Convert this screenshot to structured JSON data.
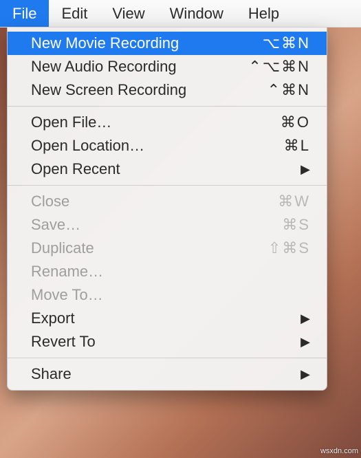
{
  "menubar": {
    "items": [
      {
        "label": "File",
        "active": true
      },
      {
        "label": "Edit",
        "active": false
      },
      {
        "label": "View",
        "active": false
      },
      {
        "label": "Window",
        "active": false
      },
      {
        "label": "Help",
        "active": false
      }
    ]
  },
  "menu": {
    "groups": [
      [
        {
          "label": "New Movie Recording",
          "shortcut": "⌥⌘N",
          "highlight": true,
          "disabled": false,
          "submenu": false
        },
        {
          "label": "New Audio Recording",
          "shortcut": "⌃⌥⌘N",
          "highlight": false,
          "disabled": false,
          "submenu": false
        },
        {
          "label": "New Screen Recording",
          "shortcut": "⌃⌘N",
          "highlight": false,
          "disabled": false,
          "submenu": false
        }
      ],
      [
        {
          "label": "Open File…",
          "shortcut": "⌘O",
          "highlight": false,
          "disabled": false,
          "submenu": false
        },
        {
          "label": "Open Location…",
          "shortcut": "⌘L",
          "highlight": false,
          "disabled": false,
          "submenu": false
        },
        {
          "label": "Open Recent",
          "shortcut": "",
          "highlight": false,
          "disabled": false,
          "submenu": true
        }
      ],
      [
        {
          "label": "Close",
          "shortcut": "⌘W",
          "highlight": false,
          "disabled": true,
          "submenu": false
        },
        {
          "label": "Save…",
          "shortcut": "⌘S",
          "highlight": false,
          "disabled": true,
          "submenu": false
        },
        {
          "label": "Duplicate",
          "shortcut": "⇧⌘S",
          "highlight": false,
          "disabled": true,
          "submenu": false
        },
        {
          "label": "Rename…",
          "shortcut": "",
          "highlight": false,
          "disabled": true,
          "submenu": false
        },
        {
          "label": "Move To…",
          "shortcut": "",
          "highlight": false,
          "disabled": true,
          "submenu": false
        },
        {
          "label": "Export",
          "shortcut": "",
          "highlight": false,
          "disabled": false,
          "submenu": true
        },
        {
          "label": "Revert To",
          "shortcut": "",
          "highlight": false,
          "disabled": false,
          "submenu": true
        }
      ],
      [
        {
          "label": "Share",
          "shortcut": "",
          "highlight": false,
          "disabled": false,
          "submenu": true
        }
      ]
    ]
  },
  "icons": {
    "submenu_glyph": "▶"
  },
  "watermark": "wsxdn.com"
}
